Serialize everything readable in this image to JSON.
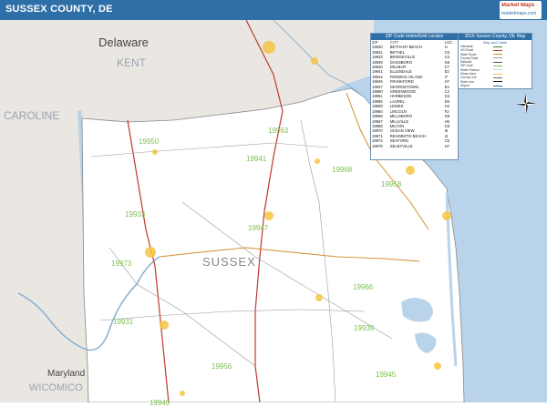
{
  "header": {
    "title": "SUSSEX COUNTY, DE",
    "logo_line1": "Market Maps",
    "logo_line2": "marketmaps.com"
  },
  "map": {
    "county_label": "SUSSEX",
    "neighbor_labels": {
      "delaware": "Delaware",
      "kent": "KENT",
      "caroline": "CAROLINE",
      "maryland": "Maryland",
      "wicomico": "WICOMICO"
    },
    "zip_labels": [
      {
        "code": "19950",
        "name": "zip-label-19950"
      },
      {
        "code": "19963",
        "name": "zip-label-19963"
      },
      {
        "code": "19941",
        "name": "zip-label-19941"
      },
      {
        "code": "19968",
        "name": "zip-label-19968"
      },
      {
        "code": "19958",
        "name": "zip-label-19958"
      },
      {
        "code": "19933",
        "name": "zip-label-19933"
      },
      {
        "code": "19947",
        "name": "zip-label-19947"
      },
      {
        "code": "19973",
        "name": "zip-label-19973"
      },
      {
        "code": "19966",
        "name": "zip-label-19966"
      },
      {
        "code": "19939",
        "name": "zip-label-19939"
      },
      {
        "code": "19931",
        "name": "zip-label-19931"
      },
      {
        "code": "19945",
        "name": "zip-label-19945"
      },
      {
        "code": "19940",
        "name": "zip-label-19940"
      },
      {
        "code": "19956",
        "name": "zip-label-19956"
      }
    ],
    "colors": {
      "water": "#b9d3ea",
      "county": "#ffffff",
      "neighbor": "#eae7e2",
      "road_major": "#c0392b",
      "road_minor": "#9a9a9a",
      "highway": "#5aa04a",
      "urban": "#f5c542",
      "zip_text": "#7cbf4f"
    }
  },
  "zip_locator": {
    "title": "ZIP Code Index/Grid Locator",
    "columns": [
      "ZIP",
      "CITY",
      "LOC"
    ],
    "rows": [
      [
        "19930",
        "BETHANY BEACH",
        "H"
      ],
      [
        "19931",
        "BETHEL",
        "C6"
      ],
      [
        "19933",
        "BRIDGEVILLE",
        "C3"
      ],
      [
        "19939",
        "DAGSBORO",
        "G6"
      ],
      [
        "19940",
        "DELMAR",
        "C7"
      ],
      [
        "19941",
        "ELLENDALE",
        "E2"
      ],
      [
        "19944",
        "FENWICK ISLAND",
        "I7"
      ],
      [
        "19945",
        "FRANKFORD",
        "H7"
      ],
      [
        "19947",
        "GEORGETOWN",
        "E4"
      ],
      [
        "19950",
        "GREENWOOD",
        "C2"
      ],
      [
        "19951",
        "HARBESON",
        "G4"
      ],
      [
        "19956",
        "LAUREL",
        "D6"
      ],
      [
        "19958",
        "LEWES",
        "H4"
      ],
      [
        "19960",
        "LINCOLN",
        "F2"
      ],
      [
        "19966",
        "MILLSBORO",
        "G5"
      ],
      [
        "19967",
        "MILLVILLE",
        "H6"
      ],
      [
        "19968",
        "MILTON",
        "G3"
      ],
      [
        "19970",
        "OCEAN VIEW",
        "I6"
      ],
      [
        "19971",
        "REHOBOTH BEACH",
        "I4"
      ],
      [
        "19973",
        "SEAFORD",
        "C5"
      ],
      [
        "19975",
        "SELBYVILLE",
        "H7"
      ]
    ]
  },
  "legend": {
    "title": "2016 Sussex County, DE Map",
    "subtitle": "Map and Table",
    "rows": [
      {
        "label": "Interstate",
        "desc": "",
        "color": "#3a7a2a"
      },
      {
        "label": "US Route",
        "desc": "",
        "color": "#c0392b"
      },
      {
        "label": "State Route",
        "desc": "",
        "color": "#d98c2b"
      },
      {
        "label": "County Road",
        "desc": "",
        "color": "#9a9a9a"
      },
      {
        "label": "Railroad",
        "desc": "",
        "color": "#555555"
      },
      {
        "label": "ZIP Code",
        "desc": "",
        "color": "#7cbf4f"
      },
      {
        "label": "Water Feature",
        "desc": "",
        "color": "#b9d3ea"
      },
      {
        "label": "Urban Area",
        "desc": "",
        "color": "#f5c542"
      },
      {
        "label": "County Line",
        "desc": "",
        "color": "#666666"
      },
      {
        "label": "State Line",
        "desc": "",
        "color": "#222222"
      },
      {
        "label": "Airport",
        "desc": "",
        "color": "#2e6fa7"
      }
    ]
  },
  "compass": {
    "north_label": "N"
  }
}
